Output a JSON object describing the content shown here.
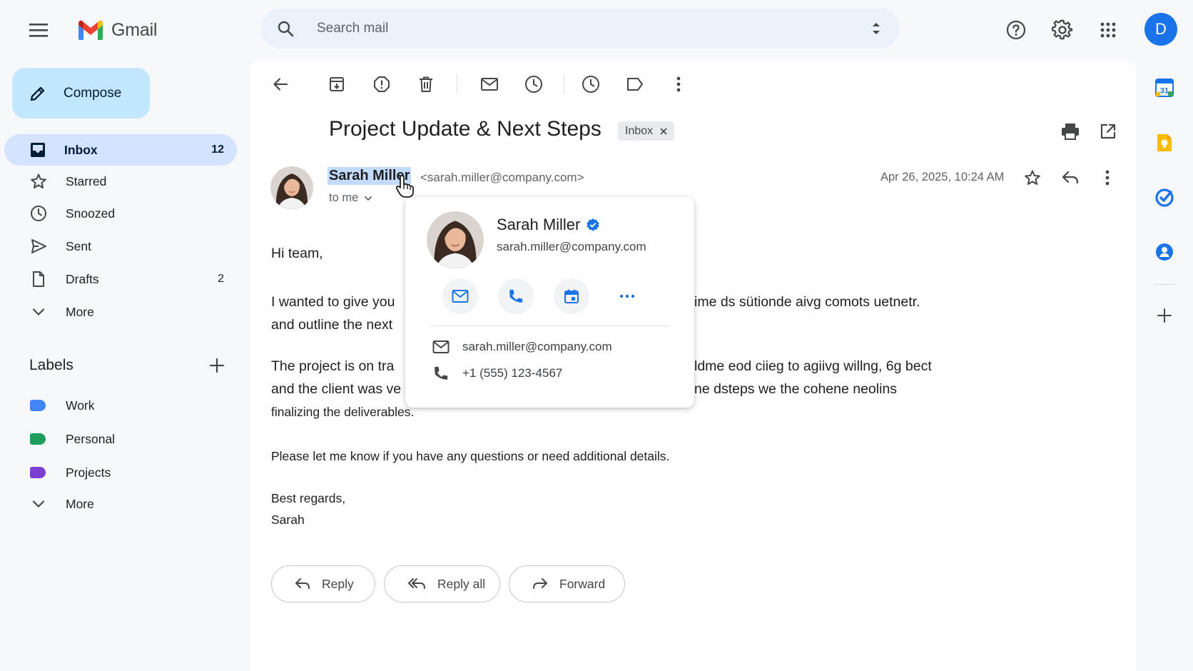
{
  "app": {
    "name": "Gmail"
  },
  "search": {
    "placeholder": "Search mail"
  },
  "header": {
    "avatar_letter": "D"
  },
  "sidebar": {
    "compose_label": "Compose",
    "items": [
      {
        "label": "Inbox",
        "count": "12",
        "icon": "inbox-icon",
        "active": true
      },
      {
        "label": "Starred",
        "count": "",
        "icon": "star-icon"
      },
      {
        "label": "Snoozed",
        "count": "",
        "icon": "clock-icon"
      },
      {
        "label": "Sent",
        "count": "",
        "icon": "send-icon"
      },
      {
        "label": "Drafts",
        "count": "2",
        "icon": "draft-icon"
      },
      {
        "label": "More",
        "count": "",
        "icon": "chevron-down-icon"
      }
    ],
    "labels_title": "Labels",
    "labels": [
      {
        "label": "Work",
        "color": "#4285f4"
      },
      {
        "label": "Personal",
        "color": "#1e9e5a"
      },
      {
        "label": "Projects",
        "color": "#7b3fd1"
      }
    ],
    "labels_more": "More"
  },
  "email": {
    "subject": "Project Update & Next Steps",
    "chip_label": "Inbox",
    "sender_name": "Sarah Miller",
    "sender_email": "<sarah.miller@company.com>",
    "recipient": "to me",
    "date": "Apr 26, 2025, 10:24 AM",
    "body": {
      "greeting": "Hi team,",
      "p1_line1_a": "I wanted to give you",
      "p1_line1_b": "ime ds sütionde aivg comots uetnetr.",
      "p1_line2": "and outline the next",
      "p2_line1_a": "The project is on tra",
      "p2_line1_b": "ldme eod ciieg to agiivg willng, 6g bect",
      "p2_line2_a": "and the client was ve",
      "p2_line2_b": "ne dsteps we the cohene neolins",
      "p2_line3": "finalizing the deliverables.",
      "p3": "Please let me know if you have any questions or need additional details.",
      "closing": "Best regards,",
      "signature": "Sarah"
    },
    "actions": {
      "reply": "Reply",
      "reply_all": "Reply all",
      "forward": "Forward"
    }
  },
  "contact_card": {
    "name": "Sarah Miller",
    "email": "sarah.miller@company.com",
    "email_row": "sarah.miller@company.com",
    "phone": "+1 (555) 123-4567",
    "accent": "#1a73e8"
  },
  "right_rail": {
    "calendar_day": "31"
  },
  "colors": {
    "accent": "#1a73e8",
    "compose_bg": "#c2e7ff",
    "active_nav_bg": "#d3e3fd",
    "page_bg": "#f6f8fc"
  }
}
